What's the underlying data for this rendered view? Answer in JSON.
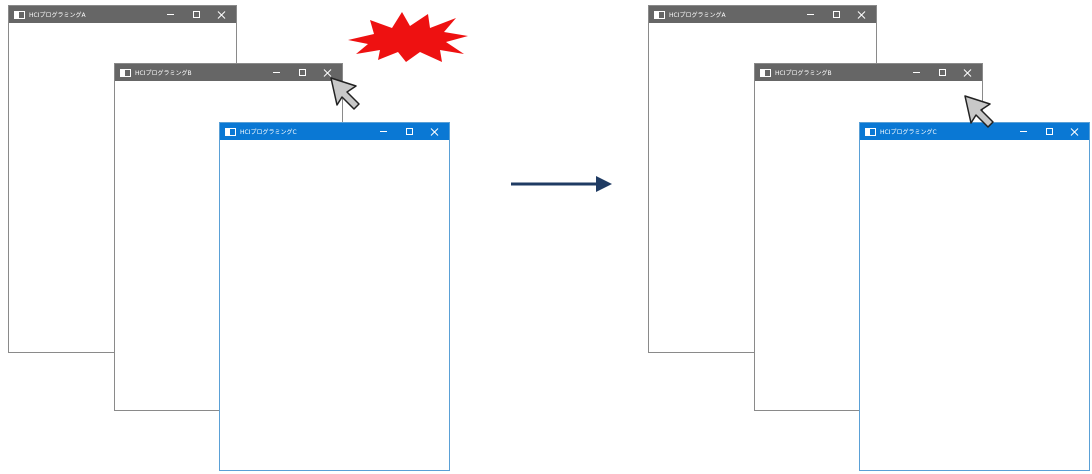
{
  "before": {
    "windows": [
      {
        "id": "a",
        "title": "HCIプログラミングA",
        "active": false
      },
      {
        "id": "b",
        "title": "HCIプログラミングB",
        "active": false
      },
      {
        "id": "c",
        "title": "HCIプログラミングC",
        "active": true
      }
    ]
  },
  "after": {
    "windows": [
      {
        "id": "a",
        "title": "HCIプログラミングA",
        "active": false
      },
      {
        "id": "b",
        "title": "HCIプログラミングB",
        "active": false
      },
      {
        "id": "c",
        "title": "HCIプログラミングC",
        "active": true
      }
    ]
  },
  "icons": {
    "click": "explosion-burst-icon",
    "pointer": "mouse-pointer-icon",
    "transition": "right-arrow-icon"
  },
  "colors": {
    "inactive_titlebar": "#666666",
    "active_titlebar": "#0a78d4",
    "burst": "#ee1111",
    "arrow": "#1f3b63"
  }
}
